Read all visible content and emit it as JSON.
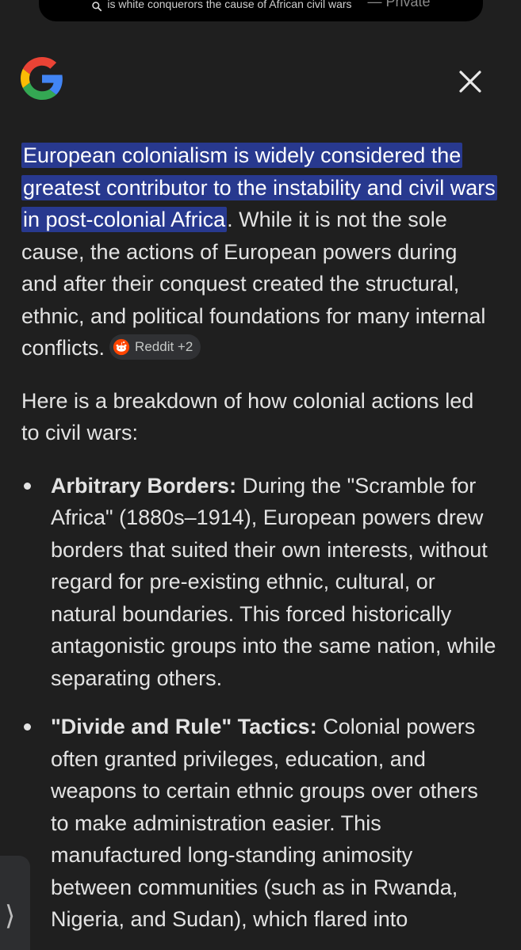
{
  "search_bar": {
    "query": "is white conquerors the cause of African civil wars",
    "mode_label": "— Private"
  },
  "header": {
    "logo": "google-g-icon",
    "close_icon": "close-icon"
  },
  "answer": {
    "highlighted_text": "European colonialism is widely considered the greatest contributor to the instability and civil wars in post-colonial Africa",
    "rest_text": ". While it is not the sole cause, the actions of European powers during and after their conquest created the structural, ethnic, and political foundations for many internal conflicts.",
    "source_chip": {
      "icon": "reddit-icon",
      "label": "Reddit +2"
    },
    "intro": "Here is a breakdown of how colonial actions led to civil wars:",
    "bullets": [
      {
        "title": "Arbitrary Borders:",
        "text": " During the \"Scramble for Africa\" (1880s–1914), European powers drew borders that suited their own interests, without regard for pre-existing ethnic, cultural, or natural boundaries. This forced historically antagonistic groups into the same nation, while separating others."
      },
      {
        "title": "\"Divide and Rule\" Tactics:",
        "text": " Colonial powers often granted privileges, education, and weapons to certain ethnic groups over others to make administration easier. This manufactured long-standing animosity between communities (such as in Rwanda, Nigeria, and Sudan), which flared into"
      }
    ]
  },
  "side_tab": {
    "icon": "chevron-right-icon",
    "glyph": "⟩"
  },
  "colors": {
    "background": "#1f1f1f",
    "highlight": "#28398f",
    "text": "#e3e3e3",
    "chip": "#303134"
  }
}
